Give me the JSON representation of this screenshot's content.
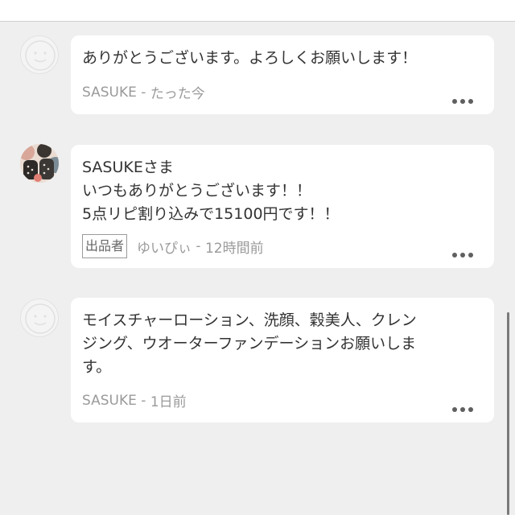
{
  "comments": [
    {
      "avatar": "default-face-icon",
      "message": "ありがとうございます。よろしくお願いします！",
      "author": "SASUKE",
      "separator": " - ",
      "time": "たった今"
    },
    {
      "avatar": "user-photo-avatar",
      "message_lines": [
        "SASUKEさま",
        "いつもありがとうございます！！",
        "5点リピ割り込みで15100円です！！"
      ],
      "badge": "出品者",
      "author": "ゆいぴぃ",
      "separator": " - ",
      "time": "12時間前"
    },
    {
      "avatar": "default-face-icon",
      "message_lines": [
        "モイスチャーローション、洗顔、穀美人、クレン",
        "ジング、ウオーターファンデーションお願いしま",
        "す。"
      ],
      "author": "SASUKE",
      "separator": " - ",
      "time": "1日前"
    }
  ],
  "colors": {
    "background": "#efefef",
    "bubble": "#ffffff",
    "meta_text": "#9a9a9a",
    "dots": "#5f5f5f"
  }
}
